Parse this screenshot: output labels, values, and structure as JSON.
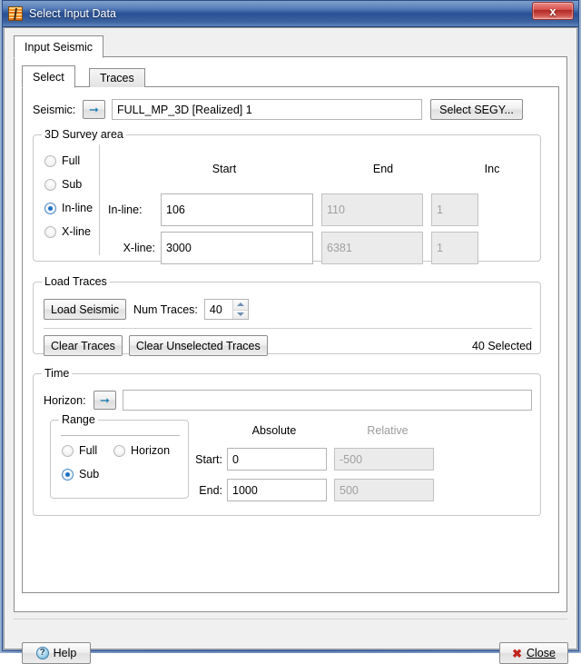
{
  "window": {
    "title": "Select Input Data",
    "app_icon": "seismic-stripes-icon",
    "close_label": "x"
  },
  "outer_tabs": [
    {
      "label": "Input Seismic",
      "active": true
    }
  ],
  "inner_tabs": [
    {
      "label": "Select",
      "active": true
    },
    {
      "label": "Traces",
      "active": false
    }
  ],
  "seismic_row": {
    "label": "Seismic:",
    "arrow_icon": "right-arrow-icon",
    "value": "FULL_MP_3D [Realized] 1",
    "select_segy_label": "Select SEGY..."
  },
  "survey": {
    "title": "3D Survey area",
    "radios": [
      {
        "label": "Full",
        "checked": false
      },
      {
        "label": "Sub",
        "checked": false
      },
      {
        "label": "In-line",
        "checked": true
      },
      {
        "label": "X-line",
        "checked": false
      }
    ],
    "columns": [
      "Start",
      "End",
      "Inc"
    ],
    "rows": [
      {
        "label": "In-line:",
        "start": "106",
        "start_disabled": false,
        "end": "110",
        "end_disabled": true,
        "inc": "1",
        "inc_disabled": true
      },
      {
        "label": "X-line:",
        "start": "3000",
        "start_disabled": false,
        "end": "6381",
        "end_disabled": true,
        "inc": "1",
        "inc_disabled": true
      }
    ]
  },
  "load_traces": {
    "title": "Load Traces",
    "load_seismic_label": "Load Seismic",
    "num_traces_label": "Num Traces:",
    "num_traces_value": "40",
    "clear_traces_label": "Clear Traces",
    "clear_unselected_label": "Clear Unselected Traces",
    "selected_status": "40 Selected"
  },
  "time": {
    "title": "Time",
    "horizon_label": "Horizon:",
    "horizon_arrow_icon": "right-arrow-icon",
    "horizon_value": "",
    "range": {
      "title": "Range",
      "radios": [
        {
          "label": "Full",
          "checked": false
        },
        {
          "label": "Horizon",
          "checked": false
        },
        {
          "label": "Sub",
          "checked": true
        }
      ]
    },
    "col_absolute": "Absolute",
    "col_relative": "Relative",
    "rows": [
      {
        "label": "Start:",
        "absolute": "0",
        "absolute_disabled": false,
        "relative": "-500",
        "relative_disabled": true
      },
      {
        "label": "End:",
        "absolute": "1000",
        "absolute_disabled": false,
        "relative": "500",
        "relative_disabled": true
      }
    ]
  },
  "footer": {
    "help_label": "Help",
    "help_icon": "question-mark-icon",
    "close_label": "Close",
    "close_icon": "red-x-icon"
  },
  "colors": {
    "titlebar_blue": "#2d5699",
    "accent_arrow": "#1f7fb5",
    "radio_selected": "#1c6fc4",
    "close_red": "#c0241c",
    "disabled_text": "#a0a0a0"
  }
}
